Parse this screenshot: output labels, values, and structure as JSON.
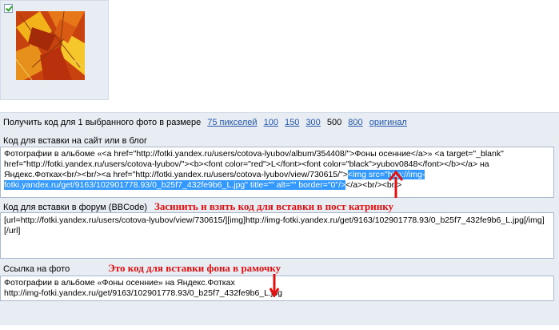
{
  "photo": {
    "alt": "autumn leaves thumbnail"
  },
  "size_bar": {
    "prefix": "Получить код для 1 выбранного фото в размере",
    "links": [
      "75 пикселей",
      "100",
      "150",
      "300"
    ],
    "current": "500",
    "links_after": [
      "800",
      "оригинал"
    ]
  },
  "blog": {
    "label": "Код для вставки на сайт или в блог",
    "code_before": "Фотографии в альбоме «<a href=\"http://fotki.yandex.ru/users/cotova-lyubov/album/354408/\">Фоны осенние</a>» <a target=\"_blank\" href=\"http://fotki.yandex.ru/users/cotova-lyubov/\"><b><font color=\"red\">L</font><font color=\"black\">yubov0848</font></b></a> на Яндекс.Фотках<br/><br/><a href=\"http://fotki.yandex.ru/users/cotova-lyubov/view/730615/\">",
    "code_highlight": "<img src=\"http://img-fotki.yandex.ru/get/9163/102901778.93/0_b25f7_432fe9b6_L.jpg\" title=\"\" alt=\"\" border=\"0\"/>",
    "code_after": "</a><br/><br/>"
  },
  "forum": {
    "label": "Код для вставки в форум (BBCode)",
    "code": "[url=http://fotki.yandex.ru/users/cotova-lyubov/view/730615/][img]http://img-fotki.yandex.ru/get/9163/102901778.93/0_b25f7_432fe9b6_L.jpg[/img][/url]"
  },
  "link": {
    "label": "Ссылка на фото",
    "line1": "Фотографии в альбоме «Фоны осенние» на Яндекс.Фотках",
    "line2": "http://img-fotki.yandex.ru/get/9163/102901778.93/0_b25f7_432fe9b6_L.jpg"
  },
  "annotations": {
    "note1": "Засинить и взять код для вставки в пост катринку",
    "note2": "Это код для вставки фона в рамочку"
  },
  "colors": {
    "annotation": "#e01010",
    "link": "#2255aa",
    "highlight": "#3399ff",
    "panel": "#e8edf4"
  }
}
